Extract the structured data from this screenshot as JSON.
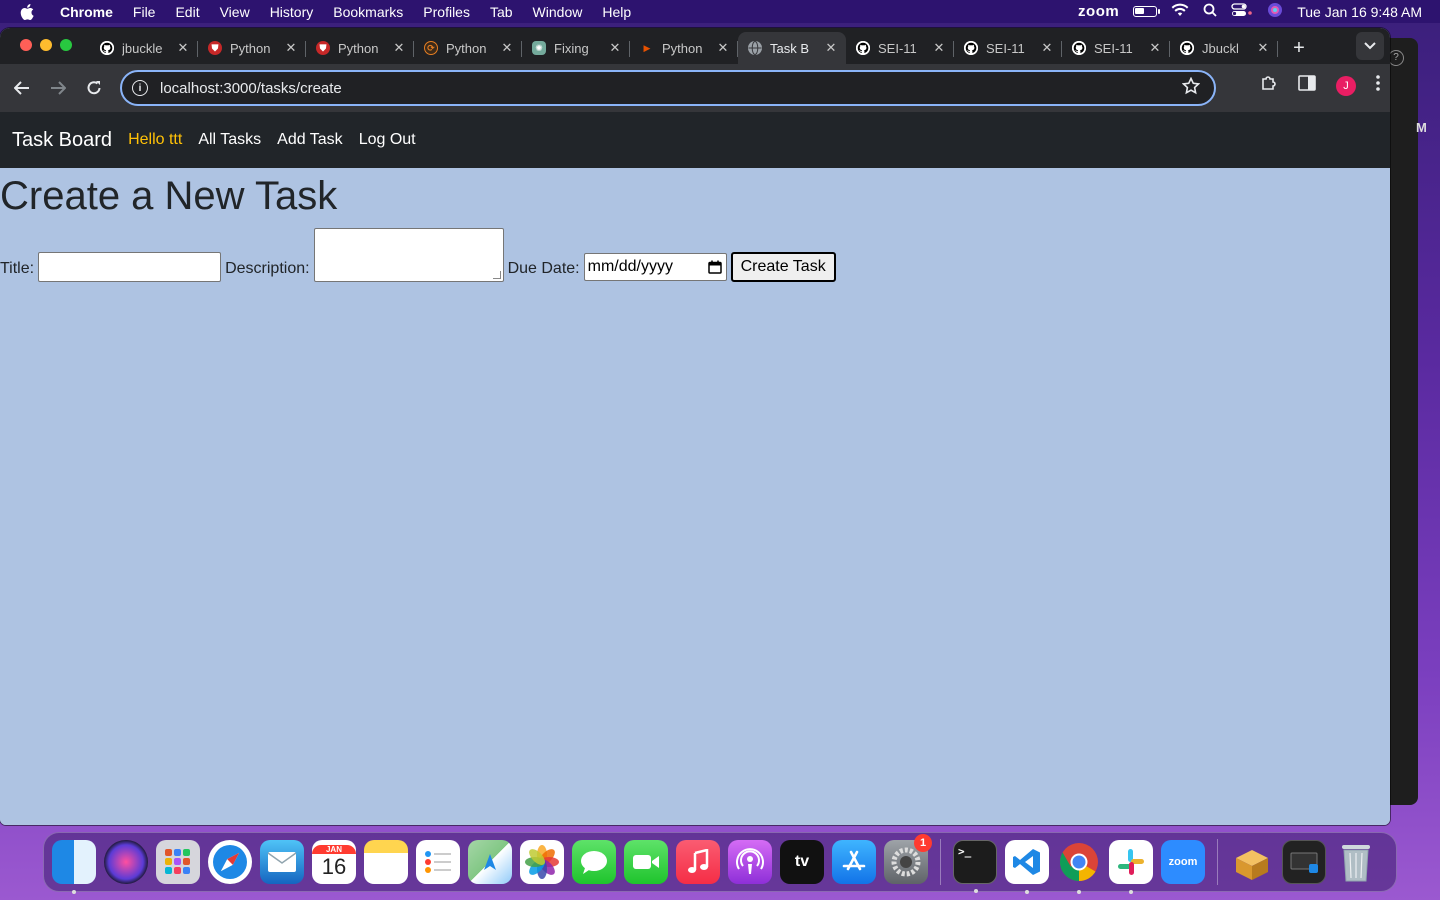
{
  "menubar": {
    "app": "Chrome",
    "items": [
      "File",
      "Edit",
      "View",
      "History",
      "Bookmarks",
      "Profiles",
      "Tab",
      "Window",
      "Help"
    ],
    "zoom_label": "zoom",
    "datetime": "Tue Jan 16  9:48 AM",
    "battery_level": 0.45
  },
  "tabs": [
    {
      "label": "jbuckle",
      "icon": "github-icon",
      "active": false
    },
    {
      "label": "Python",
      "icon": "python-red-icon",
      "active": false
    },
    {
      "label": "Python",
      "icon": "python-red-icon",
      "active": false
    },
    {
      "label": "Python",
      "icon": "python-orange-icon",
      "active": false
    },
    {
      "label": "Fixing",
      "icon": "chatgpt-icon",
      "active": false
    },
    {
      "label": "Python",
      "icon": "python-orange-flag-icon",
      "active": false
    },
    {
      "label": "Task B",
      "icon": "globe-icon",
      "active": true
    },
    {
      "label": "SEI-11",
      "icon": "github-icon",
      "active": false
    },
    {
      "label": "SEI-11",
      "icon": "github-icon",
      "active": false
    },
    {
      "label": "SEI-11",
      "icon": "github-icon",
      "active": false
    },
    {
      "label": "Jbuckl",
      "icon": "github-icon",
      "active": false
    }
  ],
  "address_bar": {
    "url": "localhost:3000/tasks/create"
  },
  "profile_initial": "J",
  "bg_window_letter": "M",
  "app_nav": {
    "brand": "Task Board",
    "greeting": "Hello ttt",
    "links": [
      "All Tasks",
      "Add Task",
      "Log Out"
    ]
  },
  "page": {
    "heading": "Create a New Task",
    "form": {
      "title_label": "Title:",
      "title_value": "",
      "description_label": "Description:",
      "description_value": "",
      "due_label": "Due Date:",
      "due_placeholder": "mm/dd/yyyy",
      "submit_label": "Create Task"
    }
  },
  "dock": {
    "calendar_month": "JAN",
    "calendar_day": "16",
    "settings_badge": "1",
    "zoom_label": "zoom",
    "apps": [
      "Finder",
      "Siri",
      "Launchpad",
      "Safari",
      "Mail",
      "Calendar",
      "Notes",
      "Reminders",
      "Maps",
      "Photos",
      "Messages",
      "FaceTime",
      "Music",
      "Podcasts",
      "TV",
      "App Store",
      "System Settings",
      "Terminal",
      "VS Code",
      "Chrome",
      "Slack",
      "Zoom",
      "Archive Utility",
      "Screen Recording",
      "Trash"
    ]
  },
  "colors": {
    "page_bg": "#aec3e2",
    "nav_bg": "#212529",
    "greeting": "#ffc107",
    "omnibox_focus": "#8ab4f8"
  }
}
